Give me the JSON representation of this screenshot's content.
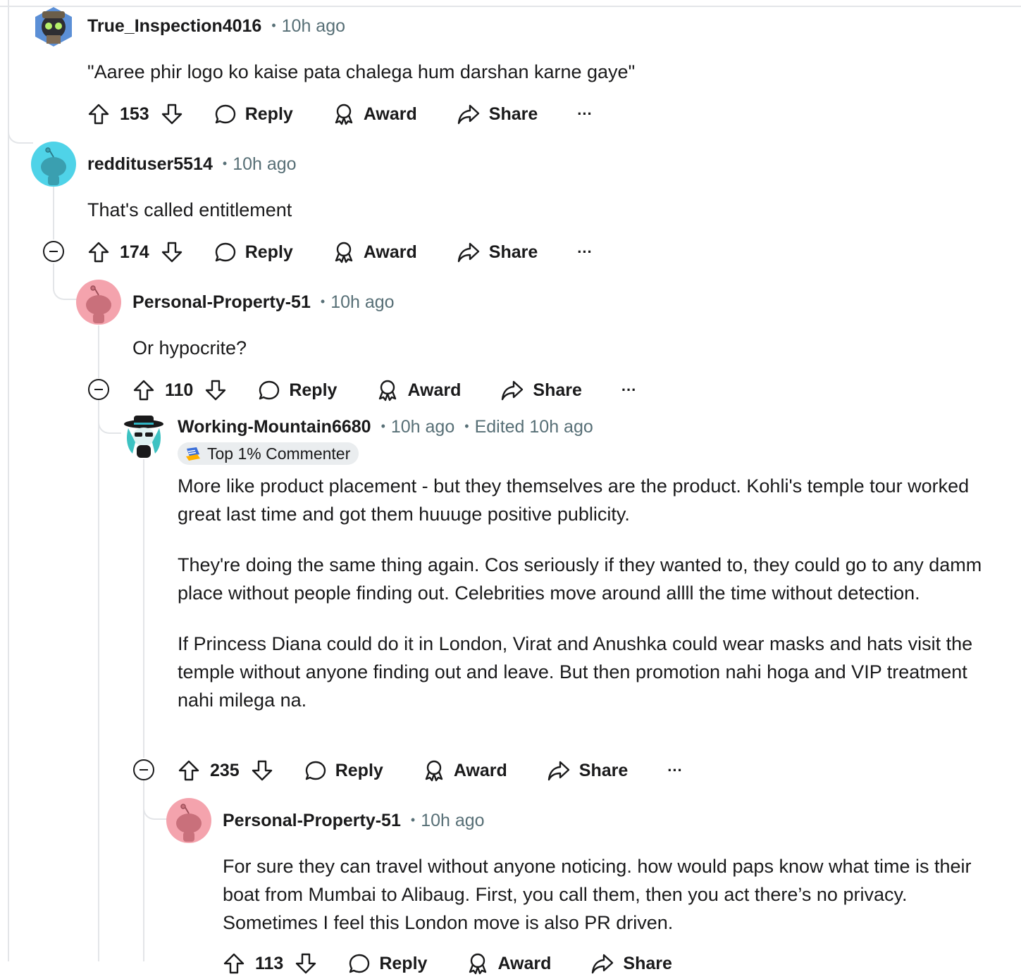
{
  "comments": [
    {
      "user": "True_Inspection4016",
      "time": "10h ago",
      "body": [
        "\"Aaree phir logo ko kaise pata chalega hum darshan karne gaye\""
      ],
      "votes": "153",
      "reply": "Reply",
      "award": "Award",
      "share": "Share",
      "more": "..."
    },
    {
      "user": "reddituser5514",
      "time": "10h ago",
      "body": [
        "That's called entitlement"
      ],
      "votes": "174",
      "reply": "Reply",
      "award": "Award",
      "share": "Share",
      "more": "..."
    },
    {
      "user": "Personal-Property-51",
      "time": "10h ago",
      "body": [
        "Or hypocrite?"
      ],
      "votes": "110",
      "reply": "Reply",
      "award": "Award",
      "share": "Share",
      "more": "..."
    },
    {
      "user": "Working-Mountain6680",
      "time": "10h ago",
      "edited": "Edited 10h ago",
      "badge": "Top 1% Commenter",
      "body": [
        "More like product placement - but they themselves are the product. Kohli's temple tour worked great last time and got them huuuge positive publicity.",
        "They're doing the same thing again. Cos seriously if they wanted to, they could go to any damm place without people finding out. Celebrities move around allll the time without detection.",
        "If Princess Diana could do it in London, Virat and Anushka could wear masks and hats visit the temple without anyone finding out and leave. But then promotion nahi hoga and VIP treatment nahi milega na."
      ],
      "votes": "235",
      "reply": "Reply",
      "award": "Award",
      "share": "Share",
      "more": "..."
    },
    {
      "user": "Personal-Property-51",
      "time": "10h ago",
      "body": [
        "For sure they can travel without anyone noticing. how would paps know what time is their boat from Mumbai to Alibaug. First, you call them, then you act there’s no privacy. Sometimes I feel this London move is also PR driven."
      ],
      "votes": "113",
      "reply": "Reply",
      "award": "Award",
      "share": "Share"
    }
  ],
  "colors": {
    "meta_gray": "#576f76",
    "thread_line": "#e3e5e8",
    "avatar_cyan": "#4fd3e8",
    "avatar_pink": "#f4a3ad",
    "badge_bg": "#eaedef"
  },
  "icons": [
    "upvote-icon",
    "downvote-icon",
    "reply-bubble-icon",
    "award-icon",
    "share-arrow-icon",
    "more-dots-icon",
    "collapse-minus-icon",
    "commenter-badge-icon"
  ]
}
